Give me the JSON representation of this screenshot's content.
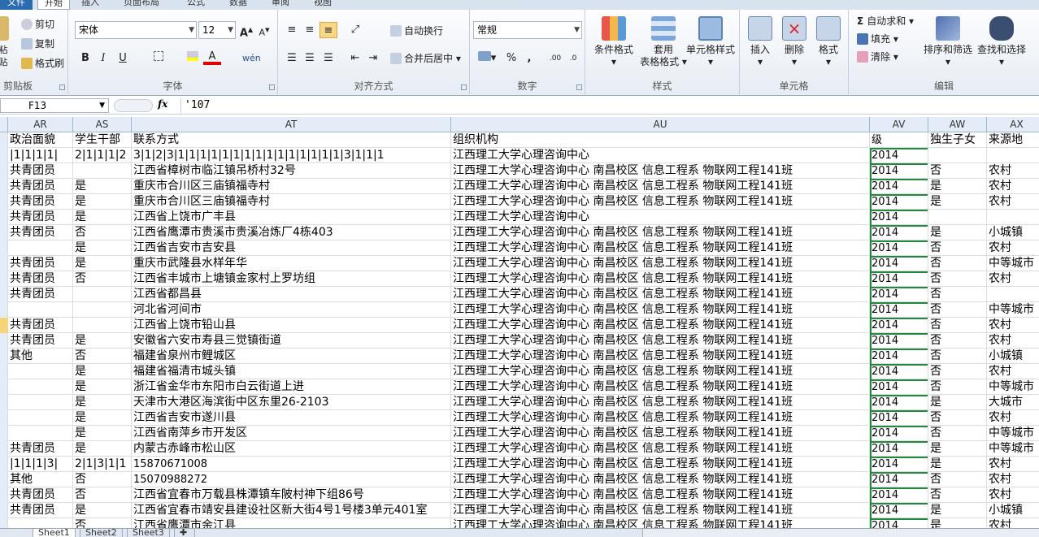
{
  "tabs": [
    "文件",
    "开始",
    "插入",
    "页面布局",
    "公式",
    "数据",
    "审阅",
    "视图"
  ],
  "ribbon": {
    "clipboard": {
      "label": "剪贴板",
      "paste": "粘贴",
      "cut": "剪切",
      "copy": "复制",
      "format_painter": "格式刷"
    },
    "font": {
      "label": "字体",
      "name": "宋体",
      "size": "12",
      "bold": "B",
      "italic": "I",
      "underline": "U",
      "grow": "A",
      "shrink": "A",
      "font_color": "A",
      "phonetic": "wén"
    },
    "alignment": {
      "label": "对齐方式",
      "wrap": "自动换行",
      "merge": "合并后居中"
    },
    "number": {
      "label": "数字",
      "format": "常规",
      "percent": "%",
      "comma": ","
    },
    "styles": {
      "label": "样式",
      "conditional": "条件格式",
      "table": "套用",
      "table2": "表格格式",
      "cell_styles": "单元格样式"
    },
    "cells": {
      "label": "单元格",
      "insert": "插入",
      "delete": "删除",
      "format": "格式"
    },
    "editing": {
      "label": "编辑",
      "autosum": "自动求和",
      "fill": "填充",
      "clear": "清除",
      "sort": "排序和筛选",
      "find": "查找和选择"
    }
  },
  "formula_bar": {
    "name_box": "F13",
    "fx": "fx",
    "content": "'107"
  },
  "columns": [
    {
      "id": "AR",
      "w": 80
    },
    {
      "id": "AS",
      "w": 72
    },
    {
      "id": "AT",
      "w": 393
    },
    {
      "id": "AU",
      "w": 515
    },
    {
      "id": "AV",
      "w": 72
    },
    {
      "id": "AW",
      "w": 72
    },
    {
      "id": "AX",
      "w": 74
    }
  ],
  "rows": [
    [
      "政治面貌",
      "学生干部",
      "联系方式",
      "组织机构",
      "级",
      "独生子女",
      "来源地"
    ],
    [
      "|1|1|1|1|",
      "2|1|1|1|2",
      "3|1|2|3|1|1|1|1|1|1|1|1|1|1|1|1|1|1|1|3|1|1|1",
      "江西理工大学心理咨询中心",
      "2014",
      "",
      ""
    ],
    [
      "共青团员",
      "",
      "江西省樟树市临江镇吊桥村32号",
      "江西理工大学心理咨询中心  南昌校区  信息工程系  物联网工程141班",
      "2014",
      "否",
      "农村"
    ],
    [
      "共青团员",
      "是",
      "重庆市合川区三庙镇福寺村",
      "江西理工大学心理咨询中心  南昌校区  信息工程系  物联网工程141班",
      "2014",
      "是",
      "农村"
    ],
    [
      "共青团员",
      "是",
      "重庆市合川区三庙镇福寺村",
      "江西理工大学心理咨询中心  南昌校区  信息工程系  物联网工程141班",
      "2014",
      "是",
      "农村"
    ],
    [
      "共青团员",
      "是",
      "江西省上饶市广丰县",
      "江西理工大学心理咨询中心",
      "2014",
      "",
      ""
    ],
    [
      "共青团员",
      "否",
      "江西省鹰潭市贵溪市贵溪冶炼厂4栋403",
      "江西理工大学心理咨询中心  南昌校区  信息工程系  物联网工程141班",
      "2014",
      "是",
      "小城镇"
    ],
    [
      "",
      "是",
      "江西省吉安市吉安县",
      "江西理工大学心理咨询中心  南昌校区  信息工程系  物联网工程141班",
      "2014",
      "否",
      "农村"
    ],
    [
      "共青团员",
      "是",
      "重庆市武隆县水样年华",
      "江西理工大学心理咨询中心  南昌校区  信息工程系  物联网工程141班",
      "2014",
      "否",
      "中等城市"
    ],
    [
      "共青团员",
      "否",
      "江西省丰城市上塘镇金家村上罗坊组",
      "江西理工大学心理咨询中心  南昌校区  信息工程系  物联网工程141班",
      "2014",
      "否",
      "农村"
    ],
    [
      "共青团员",
      "",
      "江西省都昌县",
      "江西理工大学心理咨询中心  南昌校区  信息工程系  物联网工程141班",
      "2014",
      "否",
      ""
    ],
    [
      "",
      "",
      "河北省河间市",
      "江西理工大学心理咨询中心  南昌校区  信息工程系  物联网工程141班",
      "2014",
      "否",
      "中等城市"
    ],
    [
      "共青团员",
      "",
      "江西省上饶市铅山县",
      "江西理工大学心理咨询中心  南昌校区  信息工程系  物联网工程141班",
      "2014",
      "否",
      "农村"
    ],
    [
      "共青团员",
      "是",
      "安徽省六安市寿县三觉镇街道",
      "江西理工大学心理咨询中心  南昌校区  信息工程系  物联网工程141班",
      "2014",
      "否",
      "农村"
    ],
    [
      "其他",
      "否",
      "福建省泉州市鲤城区",
      "江西理工大学心理咨询中心  南昌校区  信息工程系  物联网工程141班",
      "2014",
      "否",
      "小城镇"
    ],
    [
      "",
      "是",
      "福建省福清市城头镇",
      "江西理工大学心理咨询中心  南昌校区  信息工程系  物联网工程141班",
      "2014",
      "否",
      "农村"
    ],
    [
      "",
      "是",
      "浙江省金华市东阳市白云街道上进",
      "江西理工大学心理咨询中心  南昌校区  信息工程系  物联网工程141班",
      "2014",
      "否",
      "中等城市"
    ],
    [
      "",
      "是",
      "天津市大港区海滨街中区东里26-2103",
      "江西理工大学心理咨询中心  南昌校区  信息工程系  物联网工程141班",
      "2014",
      "是",
      "大城市"
    ],
    [
      "",
      "是",
      "江西省吉安市遂川县",
      "江西理工大学心理咨询中心  南昌校区  信息工程系  物联网工程141班",
      "2014",
      "否",
      "农村"
    ],
    [
      "",
      "是",
      "江西省南萍乡市开发区",
      "江西理工大学心理咨询中心  南昌校区  信息工程系  物联网工程141班",
      "2014",
      "否",
      "中等城市"
    ],
    [
      "共青团员",
      "是",
      "内蒙古赤峰市松山区",
      "江西理工大学心理咨询中心  南昌校区  信息工程系  物联网工程141班",
      "2014",
      "是",
      "中等城市"
    ],
    [
      "|1|1|1|3|",
      "2|1|3|1|1",
      "15870671008",
      "江西理工大学心理咨询中心  南昌校区  信息工程系  物联网工程141班",
      "2014",
      "是",
      "农村"
    ],
    [
      "其他",
      "否",
      "15070988272",
      "江西理工大学心理咨询中心  南昌校区  信息工程系  物联网工程141班",
      "2014",
      "否",
      "农村"
    ],
    [
      "共青团员",
      "否",
      "江西省宜春市万载县株潭镇车陂村神下组86号",
      "江西理工大学心理咨询中心  南昌校区  信息工程系  物联网工程141班",
      "2014",
      "否",
      "农村"
    ],
    [
      "共青团员",
      "是",
      "江西省宜春市靖安县建设社区新大街4号1号楼3单元401室",
      "江西理工大学心理咨询中心  南昌校区  信息工程系  物联网工程141班",
      "2014",
      "是",
      "小城镇"
    ],
    [
      "",
      "否",
      "江西省鹰潭市余江县",
      "江西理工大学心理咨询中心  南昌校区  信息工程系  物联网工程141班",
      "2014",
      "是",
      "农村"
    ]
  ],
  "sheet_tabs": [
    "Sheet1",
    "Sheet2",
    "Sheet3"
  ]
}
